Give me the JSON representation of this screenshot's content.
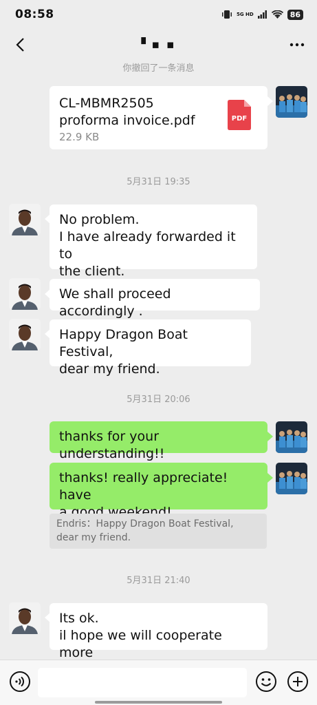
{
  "status": {
    "time": "08:58",
    "network": "5G HD",
    "battery": "86"
  },
  "header": {
    "title": "▘▪ ▪",
    "back_icon": "chevron-left-icon",
    "more_icon": "more-dots-icon"
  },
  "recall_notice": "你撤回了一条消息",
  "file_message": {
    "name_line1": "CL-MBMR2505",
    "name_line2": "proforma invoice.pdf",
    "size": "22.9 KB",
    "icon_label": "PDF"
  },
  "timestamps": [
    "5月31日 19:35",
    "5月31日 20:06",
    "5月31日 21:40"
  ],
  "messages": {
    "m1_line1": "No problem.",
    "m1_line2": "I have already forwarded it to",
    "m1_line3": "the client.",
    "m2": "We shall proceed accordingly .",
    "m3_line1": "Happy Dragon Boat Festival,",
    "m3_line2": "dear my friend.",
    "m4": "thanks for your understanding!!",
    "m5_line1": "thanks! really appreciate! have",
    "m5_line2": "a good weekend!",
    "quote_line1": "Endris：Happy Dragon Boat Festival,",
    "quote_line2": "dear my friend.",
    "m6_line1": "Its ok.",
    "m6_line2": "il hope we will cooperate  more"
  },
  "colors": {
    "green_bubble": "#95ec69",
    "background": "#ededed",
    "pdf_red": "#e8424a"
  }
}
